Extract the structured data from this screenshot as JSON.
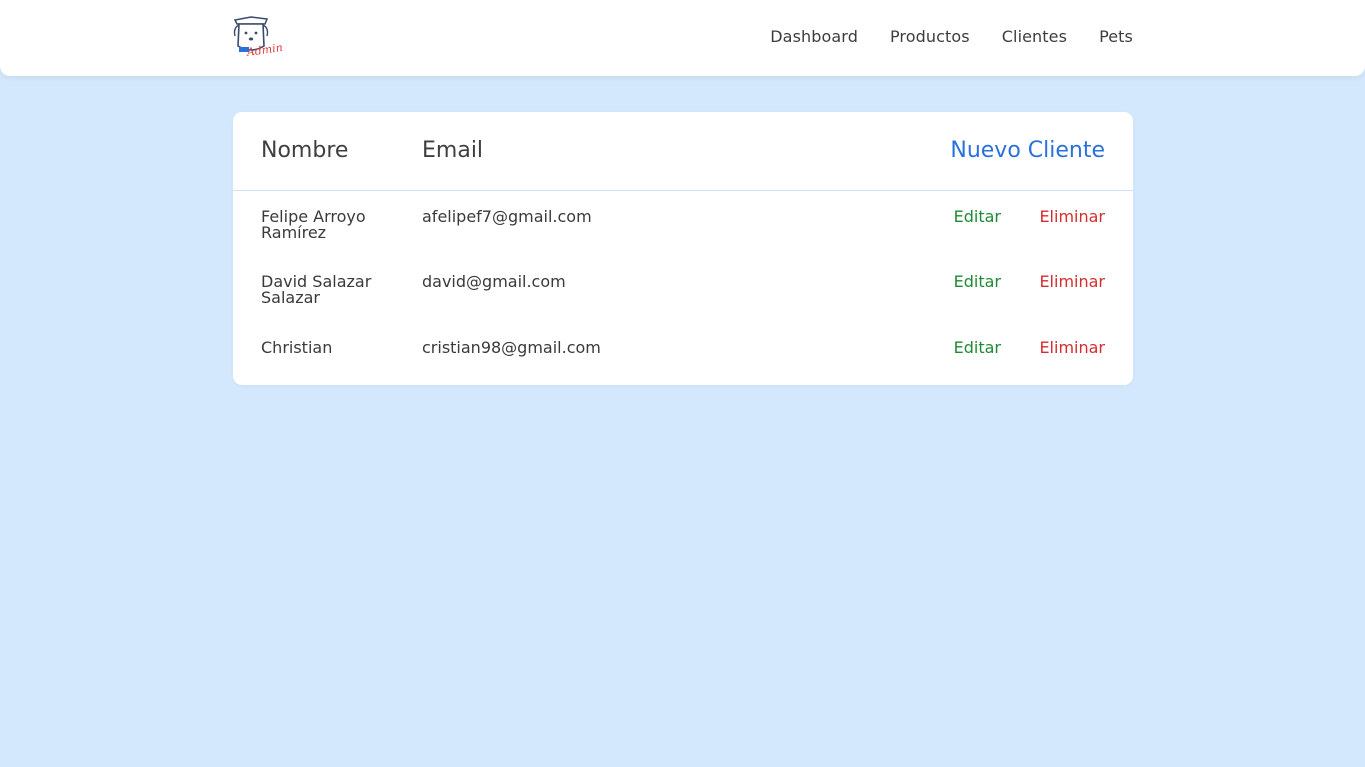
{
  "header": {
    "logo_text": "Admin",
    "nav": [
      "Dashboard",
      "Productos",
      "Clientes",
      "Pets"
    ]
  },
  "clients": {
    "columns": {
      "name": "Nombre",
      "email": "Email"
    },
    "new_label": "Nuevo Cliente",
    "edit_label": "Editar",
    "delete_label": "Eliminar",
    "rows": [
      {
        "name": "Felipe Arroyo Ramírez",
        "email": "afelipef7@gmail.com"
      },
      {
        "name": "David Salazar Salazar",
        "email": "david@gmail.com"
      },
      {
        "name": "Christian",
        "email": "cristian98@gmail.com"
      }
    ]
  },
  "colors": {
    "background": "#d4e8fd",
    "accent": "#2a72d9",
    "edit": "#1f8a35",
    "delete": "#d52d2d"
  }
}
